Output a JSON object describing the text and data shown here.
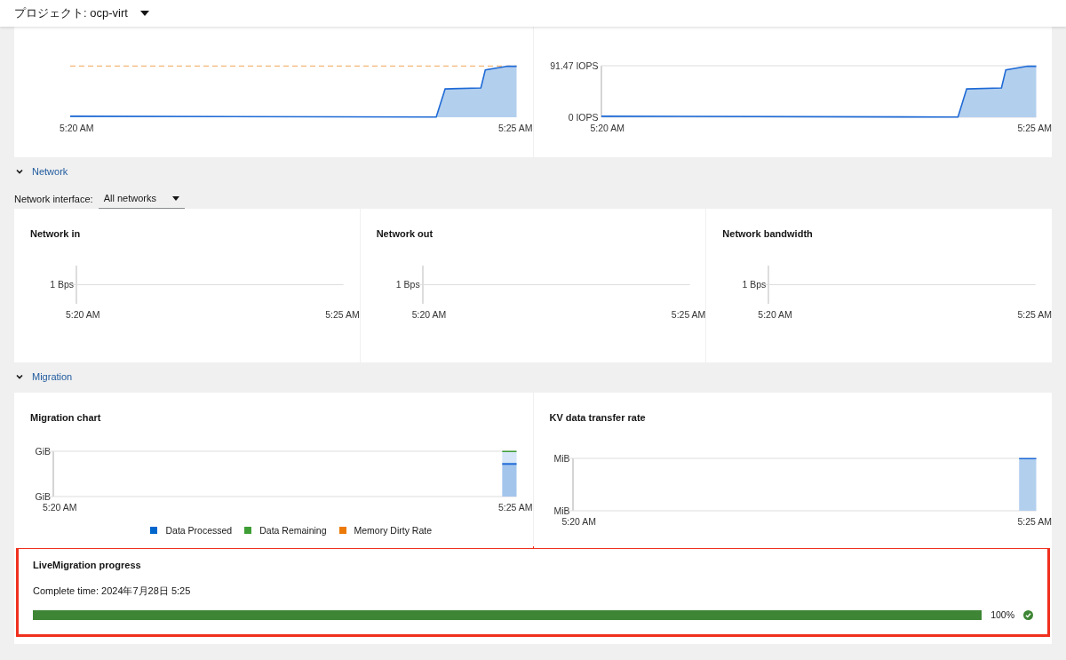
{
  "header": {
    "project_label": "プロジェクト: ocp-virt"
  },
  "storage": {
    "cards": [
      {
        "kind": "area",
        "threshold": true,
        "x_labels": [
          "5:20 AM",
          "5:25 AM"
        ]
      },
      {
        "kind": "area",
        "threshold": false,
        "y_ticks": [
          "91.47 IOPS",
          "0 IOPS"
        ],
        "x_labels": [
          "5:20 AM",
          "5:25 AM"
        ]
      }
    ]
  },
  "network": {
    "toggle": {
      "label": "Network",
      "expanded": true
    },
    "interface_label": "Network interface:",
    "interface_value": "All networks",
    "cards": [
      {
        "title": "Network in",
        "kind": "flat",
        "y_ticks": [
          "1 Bps"
        ],
        "x_labels": [
          "5:20 AM",
          "5:25 AM"
        ]
      },
      {
        "title": "Network out",
        "kind": "flat",
        "y_ticks": [
          "1 Bps"
        ],
        "x_labels": [
          "5:20 AM",
          "5:25 AM"
        ]
      },
      {
        "title": "Network bandwidth",
        "kind": "flat",
        "y_ticks": [
          "1 Bps"
        ],
        "x_labels": [
          "5:20 AM",
          "5:25 AM"
        ]
      }
    ]
  },
  "migration": {
    "toggle": {
      "label": "Migration",
      "expanded": true
    },
    "cards": [
      {
        "title": "Migration chart",
        "kind": "stacked",
        "y_ticks": [
          "GiB",
          "GiB"
        ],
        "x_labels": [
          "5:20 AM",
          "5:25 AM"
        ],
        "legend": [
          {
            "label": "Data Processed",
            "color": "#0066cc"
          },
          {
            "label": "Data Remaining",
            "color": "#3e9e35"
          },
          {
            "label": "Memory Dirty Rate",
            "color": "#ec7a08"
          }
        ]
      },
      {
        "title": "KV data transfer rate",
        "kind": "bar",
        "y_ticks": [
          "MiB",
          "MiB"
        ],
        "x_labels": [
          "5:20 AM",
          "5:25 AM"
        ]
      }
    ],
    "progress": {
      "title": "LiveMigration progress",
      "complete_time": "Complete time: 2024年7月28日 5:25",
      "level": 1,
      "reading": "100%",
      "done": true,
      "highlighted": true
    }
  }
}
